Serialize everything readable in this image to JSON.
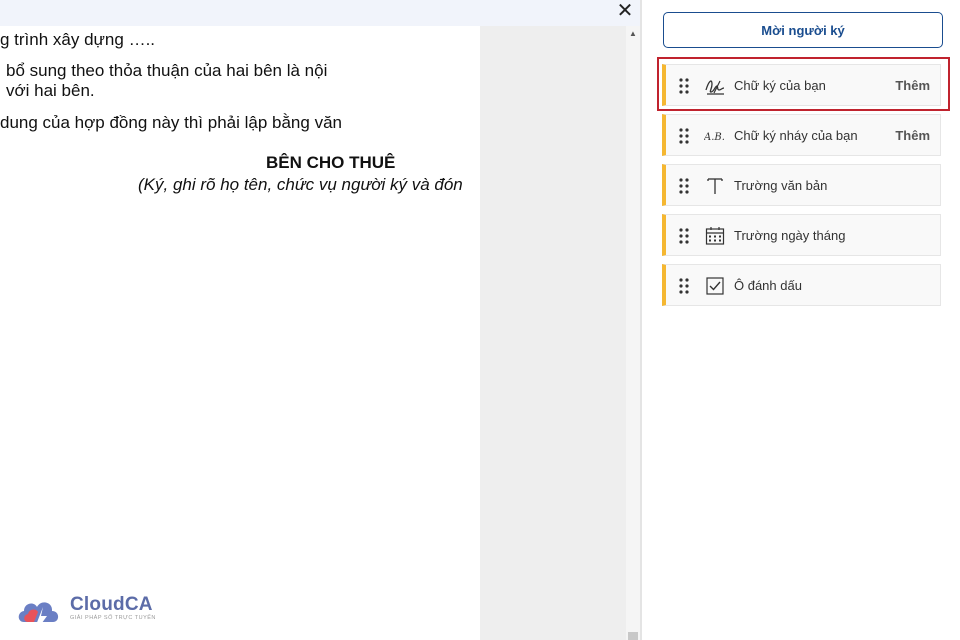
{
  "document": {
    "lines": [
      "g trình xây dựng …..",
      "bổ sung theo thỏa thuận của hai bên là nội",
      "với hai bên.",
      "dung của hợp đồng này thì phải lập bằng văn"
    ],
    "party_title": "BÊN CHO THUÊ",
    "party_note": "(Ký, ghi rõ họ tên, chức vụ người ký và đón"
  },
  "viewer": {
    "close_icon": "close-icon"
  },
  "logo": {
    "name": "CloudCA",
    "tagline": "GIẢI PHÁP SỐ TRỰC TUYẾN"
  },
  "panel": {
    "invite_label": "Mời người ký",
    "fields": [
      {
        "label": "Chữ ký của bạn",
        "action": "Thêm",
        "icon": "signature-icon",
        "highlighted": true
      },
      {
        "label": "Chữ ký nháy của bạn",
        "action": "Thêm",
        "icon": "initials-icon"
      },
      {
        "label": "Trường văn bản",
        "icon": "text-icon"
      },
      {
        "label": "Trường ngày tháng",
        "icon": "calendar-icon"
      },
      {
        "label": "Ô đánh dấu",
        "icon": "checkbox-icon"
      }
    ]
  },
  "colors": {
    "accent": "#1a4d8f",
    "field_marker": "#f5b731",
    "highlight": "#c0232e"
  }
}
